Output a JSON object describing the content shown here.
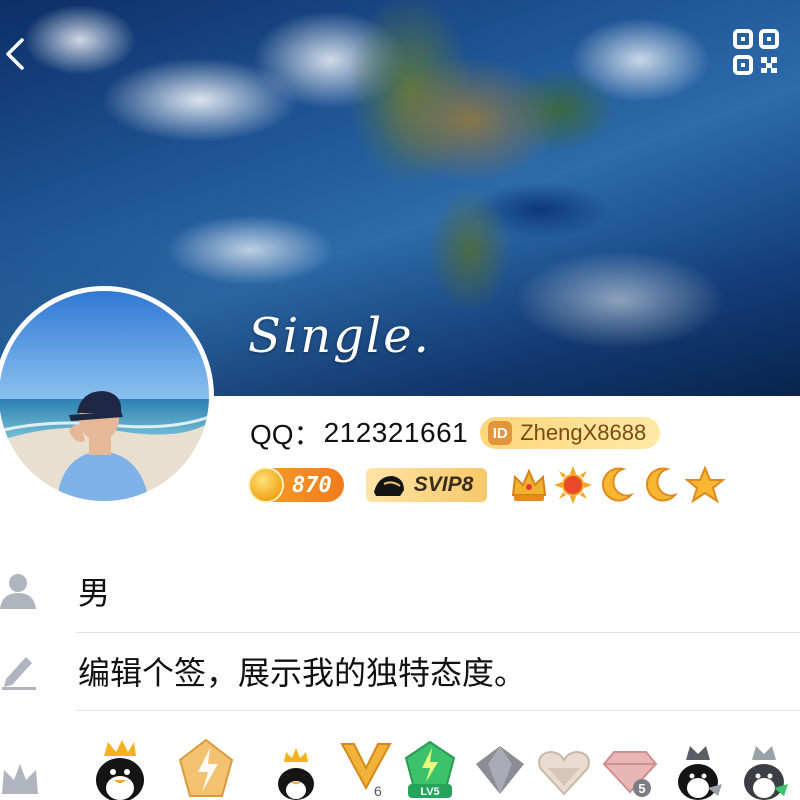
{
  "cover": {
    "nickname": "Single.",
    "back_icon": "chevron-left-icon",
    "qr_icon": "qr-code-icon"
  },
  "profile": {
    "qq_label": "QQ：",
    "qq_number": "212321661",
    "id_badge_text": "ID",
    "id_text": "ZhengX8688",
    "score": "870",
    "svip_text": "SVIP8",
    "level_icons": [
      "crown-icon",
      "sun-icon",
      "moon-icon",
      "moon-icon",
      "star-icon"
    ]
  },
  "info": {
    "gender": "男",
    "signature": "编辑个签，展示我的独特态度。",
    "gender_icon": "person-icon",
    "signature_icon": "pencil-icon"
  },
  "honors": {
    "row_icon": "crown-outline-icon",
    "items": [
      "penguin-crown-icon",
      "lightning-gem-icon",
      "penguin-crown-icon",
      "v6-badge-icon",
      "lv5-gem-icon",
      "gray-gem-icon",
      "pink-gem-icon",
      "diamond-5-icon",
      "penguin-gray-icon",
      "penguin-green-icon"
    ],
    "labels": {
      "v6": "6",
      "lv5": "LV5",
      "diamond": "5"
    }
  }
}
